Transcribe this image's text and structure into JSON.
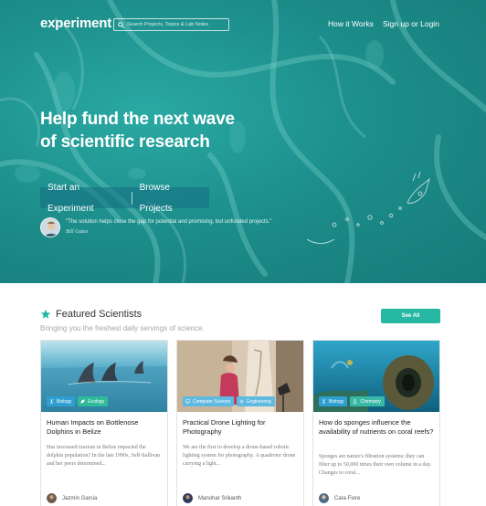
{
  "nav": {
    "logo": "experiment",
    "search_placeholder": "Search Projects, Topics & Lab Notes",
    "how_it_works": "How it Works",
    "signup_login": "Sign up or Login"
  },
  "hero": {
    "headline_line1": "Help fund the next wave",
    "headline_line2": "of scientific research",
    "start_button": "Start an Experiment",
    "browse_button": "Browse Projects",
    "quote": "\"The solution helps close the gap for potential and promising, but unfunded projects.\"",
    "quote_author": "Bill Gates"
  },
  "featured": {
    "title": "Featured Scientists",
    "subtitle": "Bringing you the freshest daily servings of science.",
    "see_all": "See All",
    "cards": [
      {
        "tags": [
          "Biology",
          "Ecology"
        ],
        "title": "Human Impacts on Bottlenose Dolphins in Belize",
        "description": "Has increased tourism in Belize impacted the dolphin population? In the late 1990s, Self-Sullivan and her peers determined...",
        "author": "Jazmin Garcia"
      },
      {
        "tags": [
          "Computer Science",
          "Engineering"
        ],
        "title": "Practical Drone Lighting for Photography",
        "description": "We are the first to develop a drone-based robotic lighting system for photography. A quadrotor drone carrying a light...",
        "author": "Manohar Srikanth"
      },
      {
        "tags": [
          "Biology",
          "Chemistry"
        ],
        "title": "How do sponges influence the availability of nutrients on coral reefs?",
        "description": "Sponges are nature's filtration systems; they can filter up to 50,000 times their own volume in a day. Changes to coral...",
        "author": "Cara Fiore"
      }
    ]
  },
  "colors": {
    "hero_teal": "#1d8f8c",
    "accent": "#27b8a3",
    "tag_blue": "#2f9ed1",
    "tag_green": "#2fba9a"
  }
}
